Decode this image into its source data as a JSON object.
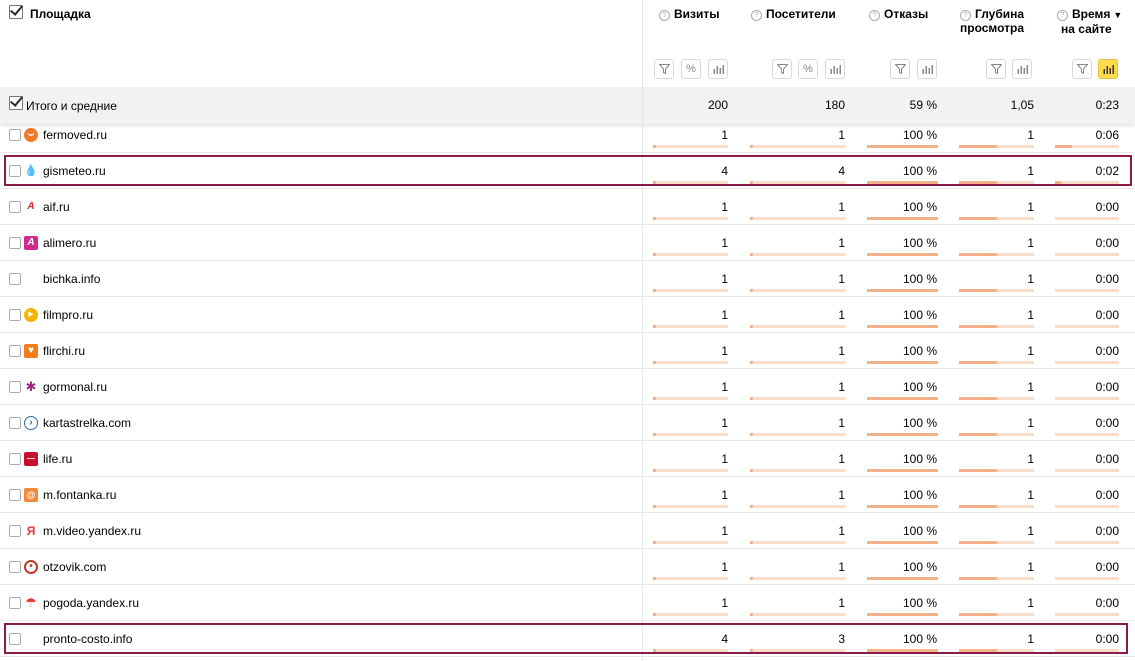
{
  "header": {
    "site_column": "Площадка",
    "columns": [
      {
        "label": "Визиты",
        "label2": ""
      },
      {
        "label": "Посетители",
        "label2": ""
      },
      {
        "label": "Отказы",
        "label2": ""
      },
      {
        "label": "Глубина",
        "label2": "просмотра"
      },
      {
        "label": "Время",
        "label2": "на сайте"
      }
    ],
    "help_glyph": "?",
    "sort_arrow": "▼",
    "percent_glyph": "%"
  },
  "totals": {
    "label": "Итого и средние",
    "visits": "200",
    "visitors": "180",
    "bounces": "59 %",
    "depth": "1,05",
    "time": "0:23"
  },
  "rows": [
    {
      "site": "fermoved.ru",
      "icon": "fermoved-favicon",
      "visits": "1",
      "visitors": "1",
      "bounces": "100 %",
      "depth": "1",
      "time": "0:06",
      "visits_share": 0.005,
      "visitors_share": 0.006,
      "bounce_share": 1.0,
      "depth_share": 0.5,
      "time_share": 0.26
    },
    {
      "site": "gismeteo.ru",
      "icon": "gismeteo-favicon",
      "visits": "4",
      "visitors": "4",
      "bounces": "100 %",
      "depth": "1",
      "time": "0:02",
      "visits_share": 0.02,
      "visitors_share": 0.022,
      "bounce_share": 1.0,
      "depth_share": 0.5,
      "time_share": 0.09
    },
    {
      "site": "aif.ru",
      "icon": "aif-favicon",
      "visits": "1",
      "visitors": "1",
      "bounces": "100 %",
      "depth": "1",
      "time": "0:00",
      "visits_share": 0.005,
      "visitors_share": 0.006,
      "bounce_share": 1.0,
      "depth_share": 0.5,
      "time_share": 0
    },
    {
      "site": "alimero.ru",
      "icon": "alimero-favicon",
      "visits": "1",
      "visitors": "1",
      "bounces": "100 %",
      "depth": "1",
      "time": "0:00",
      "visits_share": 0.005,
      "visitors_share": 0.006,
      "bounce_share": 1.0,
      "depth_share": 0.5,
      "time_share": 0
    },
    {
      "site": "bichka.info",
      "icon": "",
      "visits": "1",
      "visitors": "1",
      "bounces": "100 %",
      "depth": "1",
      "time": "0:00",
      "visits_share": 0.005,
      "visitors_share": 0.006,
      "bounce_share": 1.0,
      "depth_share": 0.5,
      "time_share": 0
    },
    {
      "site": "filmpro.ru",
      "icon": "filmpro-favicon",
      "visits": "1",
      "visitors": "1",
      "bounces": "100 %",
      "depth": "1",
      "time": "0:00",
      "visits_share": 0.005,
      "visitors_share": 0.006,
      "bounce_share": 1.0,
      "depth_share": 0.5,
      "time_share": 0
    },
    {
      "site": "flirchi.ru",
      "icon": "flirchi-favicon",
      "visits": "1",
      "visitors": "1",
      "bounces": "100 %",
      "depth": "1",
      "time": "0:00",
      "visits_share": 0.005,
      "visitors_share": 0.006,
      "bounce_share": 1.0,
      "depth_share": 0.5,
      "time_share": 0
    },
    {
      "site": "gormonal.ru",
      "icon": "gormonal-favicon",
      "visits": "1",
      "visitors": "1",
      "bounces": "100 %",
      "depth": "1",
      "time": "0:00",
      "visits_share": 0.005,
      "visitors_share": 0.006,
      "bounce_share": 1.0,
      "depth_share": 0.5,
      "time_share": 0
    },
    {
      "site": "kartastrelka.com",
      "icon": "kartastrelka-favicon",
      "visits": "1",
      "visitors": "1",
      "bounces": "100 %",
      "depth": "1",
      "time": "0:00",
      "visits_share": 0.005,
      "visitors_share": 0.006,
      "bounce_share": 1.0,
      "depth_share": 0.5,
      "time_share": 0
    },
    {
      "site": "life.ru",
      "icon": "life-favicon",
      "visits": "1",
      "visitors": "1",
      "bounces": "100 %",
      "depth": "1",
      "time": "0:00",
      "visits_share": 0.005,
      "visitors_share": 0.006,
      "bounce_share": 1.0,
      "depth_share": 0.5,
      "time_share": 0
    },
    {
      "site": "m.fontanka.ru",
      "icon": "fontanka-favicon",
      "visits": "1",
      "visitors": "1",
      "bounces": "100 %",
      "depth": "1",
      "time": "0:00",
      "visits_share": 0.005,
      "visitors_share": 0.006,
      "bounce_share": 1.0,
      "depth_share": 0.5,
      "time_share": 0
    },
    {
      "site": "m.video.yandex.ru",
      "icon": "yandex-favicon",
      "visits": "1",
      "visitors": "1",
      "bounces": "100 %",
      "depth": "1",
      "time": "0:00",
      "visits_share": 0.005,
      "visitors_share": 0.006,
      "bounce_share": 1.0,
      "depth_share": 0.5,
      "time_share": 0
    },
    {
      "site": "otzovik.com",
      "icon": "otzovik-favicon",
      "visits": "1",
      "visitors": "1",
      "bounces": "100 %",
      "depth": "1",
      "time": "0:00",
      "visits_share": 0.005,
      "visitors_share": 0.006,
      "bounce_share": 1.0,
      "depth_share": 0.5,
      "time_share": 0
    },
    {
      "site": "pogoda.yandex.ru",
      "icon": "pogoda-favicon",
      "visits": "1",
      "visitors": "1",
      "bounces": "100 %",
      "depth": "1",
      "time": "0:00",
      "visits_share": 0.005,
      "visitors_share": 0.006,
      "bounce_share": 1.0,
      "depth_share": 0.5,
      "time_share": 0
    },
    {
      "site": "pronto-costo.info",
      "icon": "",
      "visits": "4",
      "visitors": "3",
      "bounces": "100 %",
      "depth": "1",
      "time": "0:00",
      "visits_share": 0.02,
      "visitors_share": 0.017,
      "bounce_share": 1.0,
      "depth_share": 0.5,
      "time_share": 0
    }
  ],
  "highlighted_rows": [
    "gismeteo.ru",
    "pronto-costo.info"
  ],
  "colors": {
    "highlight_border": "#8b1a4a",
    "bar_track": "#f7dcc8",
    "bar_fill": "#f2b38a",
    "active_button": "#ffdb4d",
    "totals_bg": "#f2f2f2"
  }
}
